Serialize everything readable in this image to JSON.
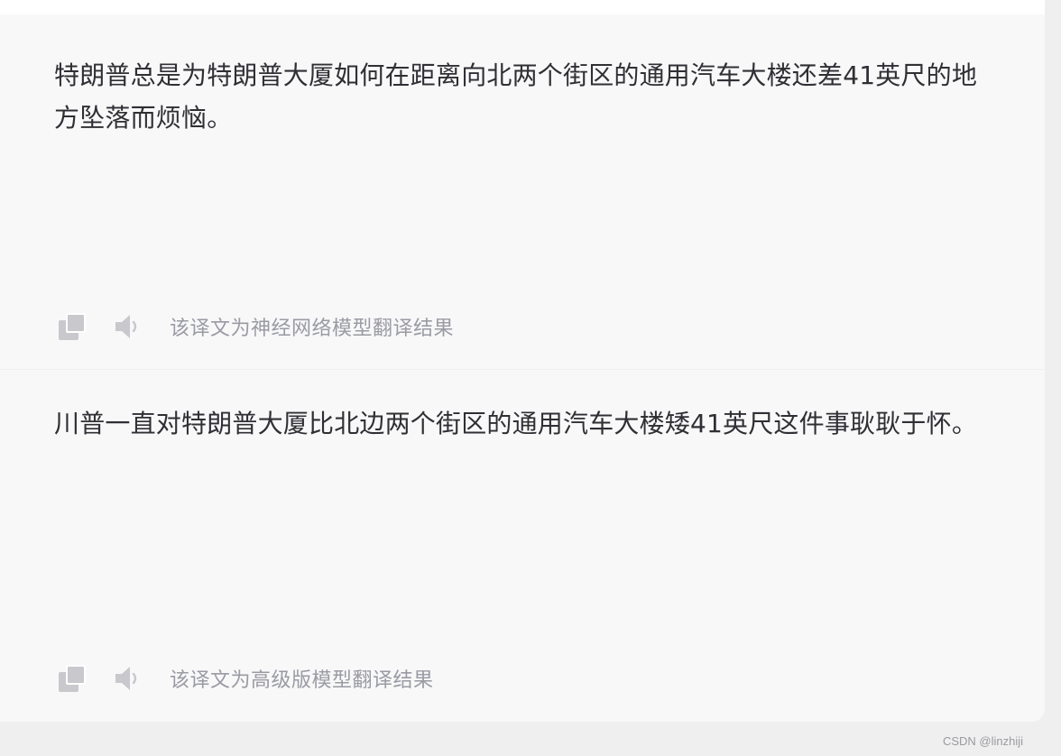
{
  "results": [
    {
      "text": "特朗普总是为特朗普大厦如何在距离向北两个街区的通用汽车大楼还差41英尺的地方坠落而烦恼。",
      "note": "该译文为神经网络模型翻译结果",
      "copy_icon": "copy-icon",
      "speaker_icon": "speaker-icon"
    },
    {
      "text": "川普一直对特朗普大厦比北边两个街区的通用汽车大楼矮41英尺这件事耿耿于怀。",
      "note": "该译文为高级版模型翻译结果",
      "copy_icon": "copy-icon",
      "speaker_icon": "speaker-icon"
    }
  ],
  "watermark": "CSDN @linzhiji",
  "colors": {
    "page_background": "#efeff0",
    "panel_background": "#f8f8f9",
    "text": "#2f2f34",
    "muted_text": "#9a9ba3",
    "icon": "#c8c8cd"
  }
}
